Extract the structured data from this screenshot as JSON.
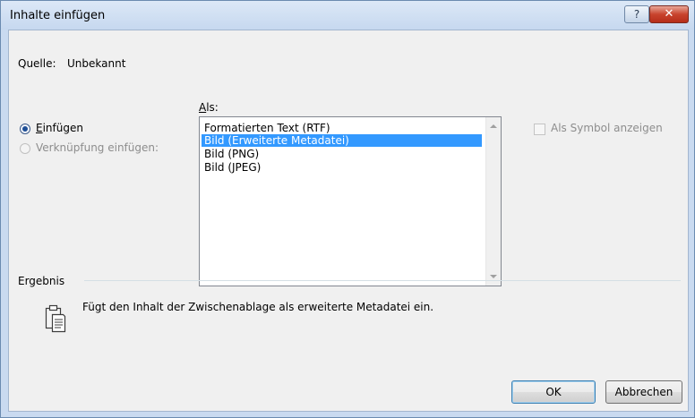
{
  "window": {
    "title": "Inhalte einfügen",
    "help_button": "?",
    "close_button": "✕"
  },
  "source": {
    "label": "Quelle:",
    "value": "Unbekannt"
  },
  "paste_options": {
    "paste_label": "Einfügen",
    "paste_selected": true,
    "link_label": "Verknüpfung einfügen:",
    "link_enabled": false
  },
  "as_list": {
    "label": "Als:",
    "items": [
      {
        "label": "Formatierten Text (RTF)",
        "selected": false
      },
      {
        "label": "Bild (Erweiterte Metadatei)",
        "selected": true
      },
      {
        "label": "Bild (PNG)",
        "selected": false
      },
      {
        "label": "Bild (JPEG)",
        "selected": false
      }
    ]
  },
  "display_as_icon": {
    "label": "Als Symbol anzeigen",
    "checked": false,
    "enabled": false
  },
  "result": {
    "group_label": "Ergebnis",
    "description": "Fügt den Inhalt der Zwischenablage als erweiterte Metadatei ein.",
    "icon": "clipboard-icon"
  },
  "buttons": {
    "ok": "OK",
    "cancel": "Abbrechen"
  },
  "colors": {
    "selection": "#3399ff",
    "disabled_text": "#8d8d8d",
    "close_button": "#c8432d"
  }
}
